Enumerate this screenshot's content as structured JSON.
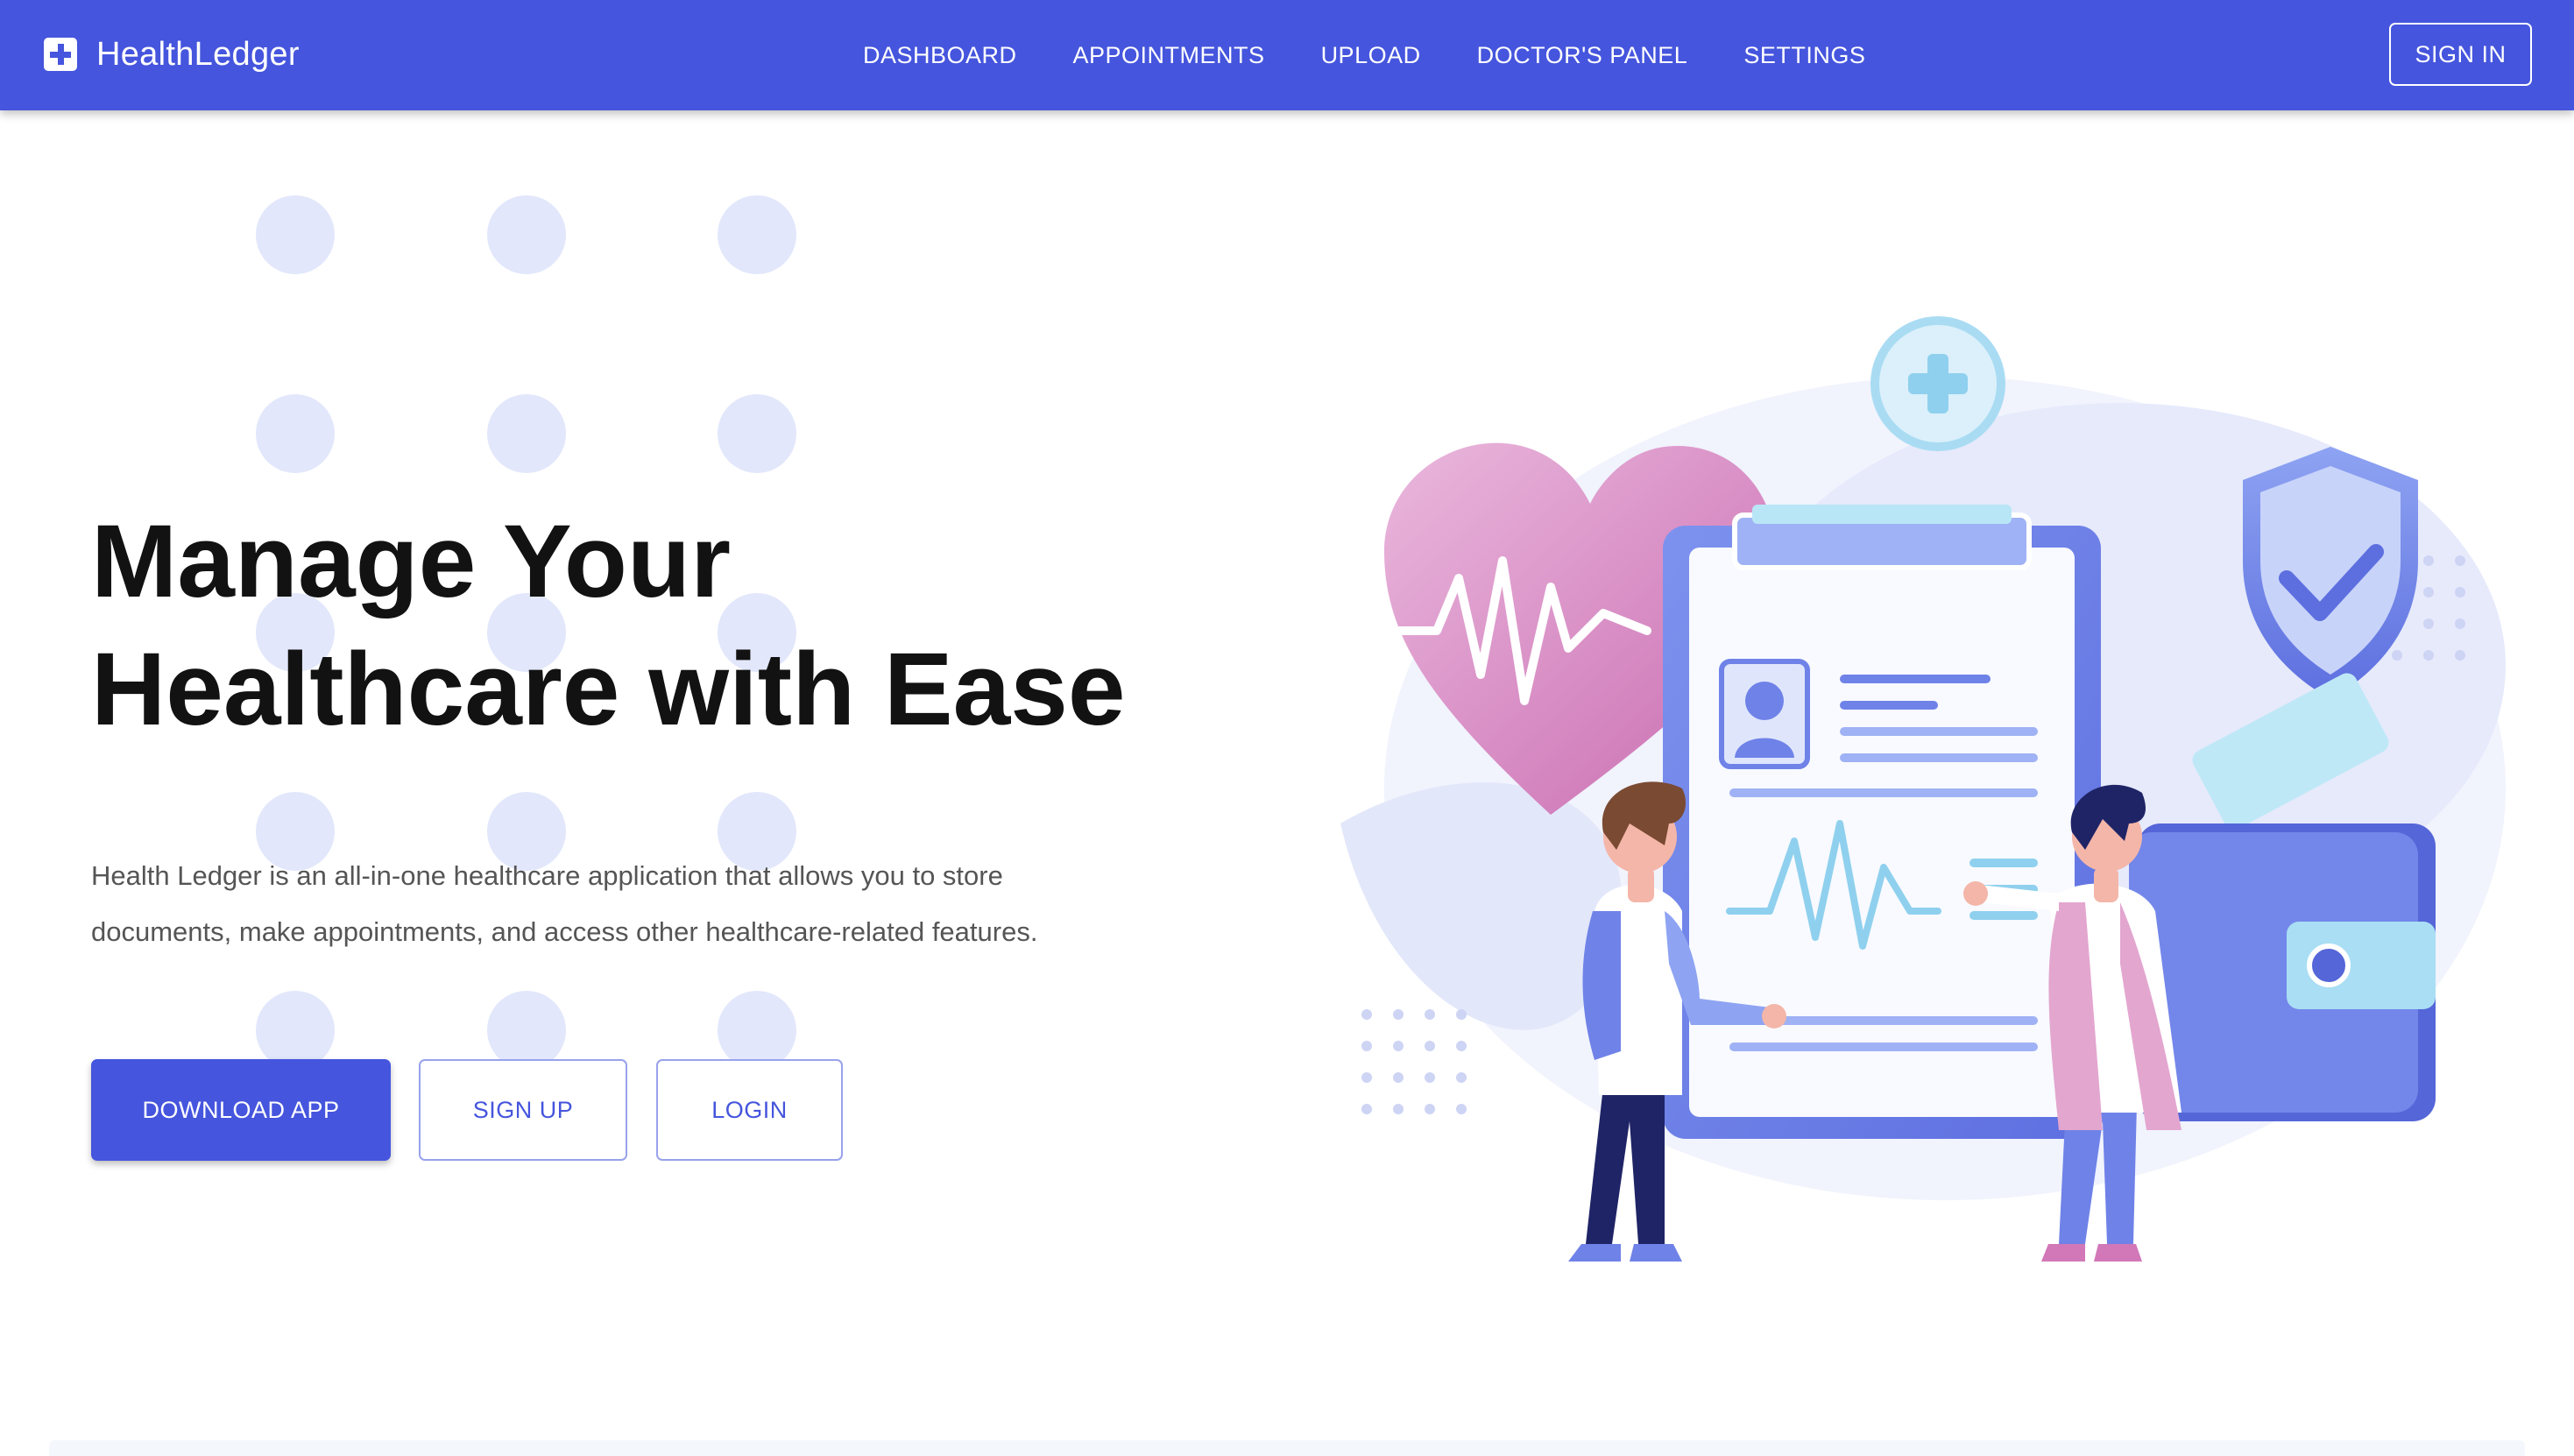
{
  "app": {
    "brand_name": "HealthLedger",
    "brand_icon": "medical-cross-icon"
  },
  "nav": {
    "items": [
      {
        "label": "DASHBOARD"
      },
      {
        "label": "APPOINTMENTS"
      },
      {
        "label": "UPLOAD"
      },
      {
        "label": "DOCTOR'S PANEL"
      },
      {
        "label": "SETTINGS"
      }
    ],
    "signin_label": "SIGN IN"
  },
  "hero": {
    "title_line1": "Manage Your",
    "title_line2": "Healthcare with Ease",
    "description_line1": "Health Ledger is an all-in-one healthcare application that allows you to store",
    "description_line2": "documents, make appointments, and access other healthcare-related features.",
    "buttons": {
      "download": "DOWNLOAD APP",
      "signup": "SIGN UP",
      "login": "LOGIN"
    }
  },
  "colors": {
    "primary": "#4555dd",
    "dot_pattern": "#e2e7fb",
    "title": "#121212",
    "body_text": "#555555"
  }
}
